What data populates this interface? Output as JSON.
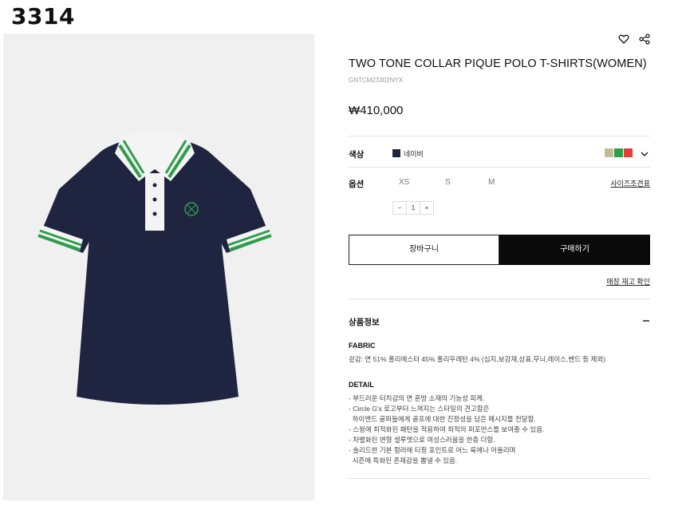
{
  "page_number": "3314",
  "product": {
    "title": "TWO TONE COLLAR PIQUE POLO T-SHIRTS(WOMEN)",
    "code": "GNTCM23302NYX",
    "price": "₩410,000"
  },
  "color": {
    "label": "색상",
    "selected": "네이비",
    "selected_hex": "#1f2540",
    "swatches": [
      "#c8b89a",
      "#2e9e4a",
      "#e0403a"
    ]
  },
  "option": {
    "label": "옵션",
    "sizes": [
      "XS",
      "S",
      "M"
    ],
    "size_guide": "사이즈조견표"
  },
  "quantity": {
    "minus": "−",
    "value": "1",
    "plus": "+"
  },
  "buttons": {
    "cart": "장바구니",
    "buy": "구매하기",
    "stock": "매장 재고 확인"
  },
  "info": {
    "heading": "상품정보",
    "collapse_symbol": "−",
    "fabric_title": "FABRIC",
    "fabric_text": "겉감: 면 51% 폴리에스터 45% 폴리우레탄 4% (심지,보강재,상표,무늬,레이스,밴드 등 제외)",
    "detail_title": "DETAIL",
    "detail_lines": [
      "- 부드러운 터치감의 면 혼방 소재의 기능성 피케.",
      "- Circle G's 로고부터 느껴지는 스타일의 견고함은",
      "  하이엔드 골퍼들에게 골프에 대한 진정성을 담은 메시지를 전달함.",
      "- 스윙에 최적화된 패턴을 적용하여 최적의 퍼포먼스를 보여줄 수 있음.",
      "- 차별화된 변형 셜루엣으로 여성스러움을 한층 더함.",
      "- 솔리드한 기본 컬러에 티핑 포인트로 어느 룩에나 어울리며",
      "  시즌에 특화된 존재감을 뽐낼 수 있음."
    ]
  },
  "colors": {
    "shirt": "#1f2540",
    "green": "#2e9e4a",
    "white": "#f4f4f4"
  }
}
